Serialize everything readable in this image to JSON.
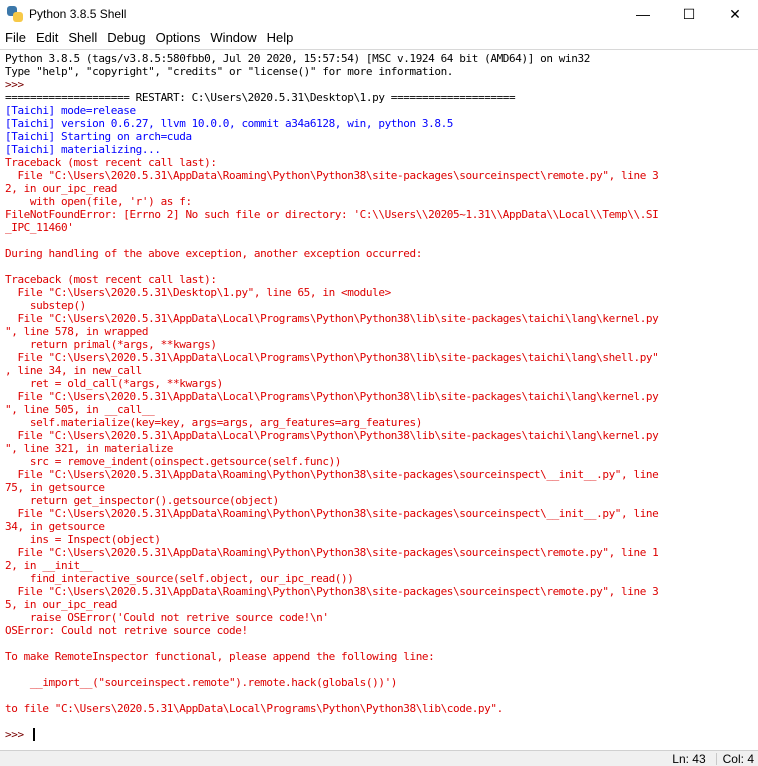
{
  "window": {
    "title": "Python 3.8.5 Shell",
    "minimize": "—",
    "maximize": "☐",
    "close": "✕"
  },
  "menu": [
    "File",
    "Edit",
    "Shell",
    "Debug",
    "Options",
    "Window",
    "Help"
  ],
  "shell": {
    "lines": [
      {
        "text": "Python 3.8.5 (tags/v3.8.5:580fbb0, Jul 20 2020, 15:57:54) [MSC v.1924 64 bit (AMD64)] on win32",
        "color": "black"
      },
      {
        "text": "Type \"help\", \"copyright\", \"credits\" or \"license()\" for more information.",
        "color": "black"
      },
      {
        "text": ">>> ",
        "color": "prompt"
      },
      {
        "text": "==================== RESTART: C:\\Users\\2020.5.31\\Desktop\\1.py ====================",
        "color": "black"
      },
      {
        "text": "[Taichi] mode=release",
        "color": "blue"
      },
      {
        "text": "[Taichi] version 0.6.27, llvm 10.0.0, commit a34a6128, win, python 3.8.5",
        "color": "blue"
      },
      {
        "text": "[Taichi] Starting on arch=cuda",
        "color": "blue"
      },
      {
        "text": "[Taichi] materializing...",
        "color": "blue"
      },
      {
        "text": "Traceback (most recent call last):",
        "color": "red"
      },
      {
        "text": "  File \"C:\\Users\\2020.5.31\\AppData\\Roaming\\Python\\Python38\\site-packages\\sourceinspect\\remote.py\", line 3",
        "color": "red"
      },
      {
        "text": "2, in our_ipc_read",
        "color": "red"
      },
      {
        "text": "    with open(file, 'r') as f:",
        "color": "red"
      },
      {
        "text": "FileNotFoundError: [Errno 2] No such file or directory: 'C:\\\\Users\\\\20205~1.31\\\\AppData\\\\Local\\\\Temp\\\\.SI",
        "color": "red"
      },
      {
        "text": "_IPC_11460'",
        "color": "red"
      },
      {
        "text": "",
        "color": "red"
      },
      {
        "text": "During handling of the above exception, another exception occurred:",
        "color": "red"
      },
      {
        "text": "",
        "color": "red"
      },
      {
        "text": "Traceback (most recent call last):",
        "color": "red"
      },
      {
        "text": "  File \"C:\\Users\\2020.5.31\\Desktop\\1.py\", line 65, in <module>",
        "color": "red"
      },
      {
        "text": "    substep()",
        "color": "red"
      },
      {
        "text": "  File \"C:\\Users\\2020.5.31\\AppData\\Local\\Programs\\Python\\Python38\\lib\\site-packages\\taichi\\lang\\kernel.py",
        "color": "red"
      },
      {
        "text": "\", line 578, in wrapped",
        "color": "red"
      },
      {
        "text": "    return primal(*args, **kwargs)",
        "color": "red"
      },
      {
        "text": "  File \"C:\\Users\\2020.5.31\\AppData\\Local\\Programs\\Python\\Python38\\lib\\site-packages\\taichi\\lang\\shell.py\"",
        "color": "red"
      },
      {
        "text": ", line 34, in new_call",
        "color": "red"
      },
      {
        "text": "    ret = old_call(*args, **kwargs)",
        "color": "red"
      },
      {
        "text": "  File \"C:\\Users\\2020.5.31\\AppData\\Local\\Programs\\Python\\Python38\\lib\\site-packages\\taichi\\lang\\kernel.py",
        "color": "red"
      },
      {
        "text": "\", line 505, in __call__",
        "color": "red"
      },
      {
        "text": "    self.materialize(key=key, args=args, arg_features=arg_features)",
        "color": "red"
      },
      {
        "text": "  File \"C:\\Users\\2020.5.31\\AppData\\Local\\Programs\\Python\\Python38\\lib\\site-packages\\taichi\\lang\\kernel.py",
        "color": "red"
      },
      {
        "text": "\", line 321, in materialize",
        "color": "red"
      },
      {
        "text": "    src = remove_indent(oinspect.getsource(self.func))",
        "color": "red"
      },
      {
        "text": "  File \"C:\\Users\\2020.5.31\\AppData\\Roaming\\Python\\Python38\\site-packages\\sourceinspect\\__init__.py\", line",
        "color": "red"
      },
      {
        "text": "75, in getsource",
        "color": "red"
      },
      {
        "text": "    return get_inspector().getsource(object)",
        "color": "red"
      },
      {
        "text": "  File \"C:\\Users\\2020.5.31\\AppData\\Roaming\\Python\\Python38\\site-packages\\sourceinspect\\__init__.py\", line",
        "color": "red"
      },
      {
        "text": "34, in getsource",
        "color": "red"
      },
      {
        "text": "    ins = Inspect(object)",
        "color": "red"
      },
      {
        "text": "  File \"C:\\Users\\2020.5.31\\AppData\\Roaming\\Python\\Python38\\site-packages\\sourceinspect\\remote.py\", line 1",
        "color": "red"
      },
      {
        "text": "2, in __init__",
        "color": "red"
      },
      {
        "text": "    find_interactive_source(self.object, our_ipc_read())",
        "color": "red"
      },
      {
        "text": "  File \"C:\\Users\\2020.5.31\\AppData\\Roaming\\Python\\Python38\\site-packages\\sourceinspect\\remote.py\", line 3",
        "color": "red"
      },
      {
        "text": "5, in our_ipc_read",
        "color": "red"
      },
      {
        "text": "    raise OSError('Could not retrive source code!\\n'",
        "color": "red"
      },
      {
        "text": "OSError: Could not retrive source code!",
        "color": "red"
      },
      {
        "text": "",
        "color": "red"
      },
      {
        "text": "To make RemoteInspector functional, please append the following line:",
        "color": "red"
      },
      {
        "text": "",
        "color": "red"
      },
      {
        "text": "    __import__(\"sourceinspect.remote\").remote.hack(globals())')",
        "color": "red"
      },
      {
        "text": "",
        "color": "red"
      },
      {
        "text": "to file \"C:\\Users\\2020.5.31\\AppData\\Local\\Programs\\Python\\Python38\\lib\\code.py\".",
        "color": "red"
      }
    ],
    "prompt": ">>> "
  },
  "status": {
    "line": "Ln: 43",
    "col": "Col: 4"
  }
}
